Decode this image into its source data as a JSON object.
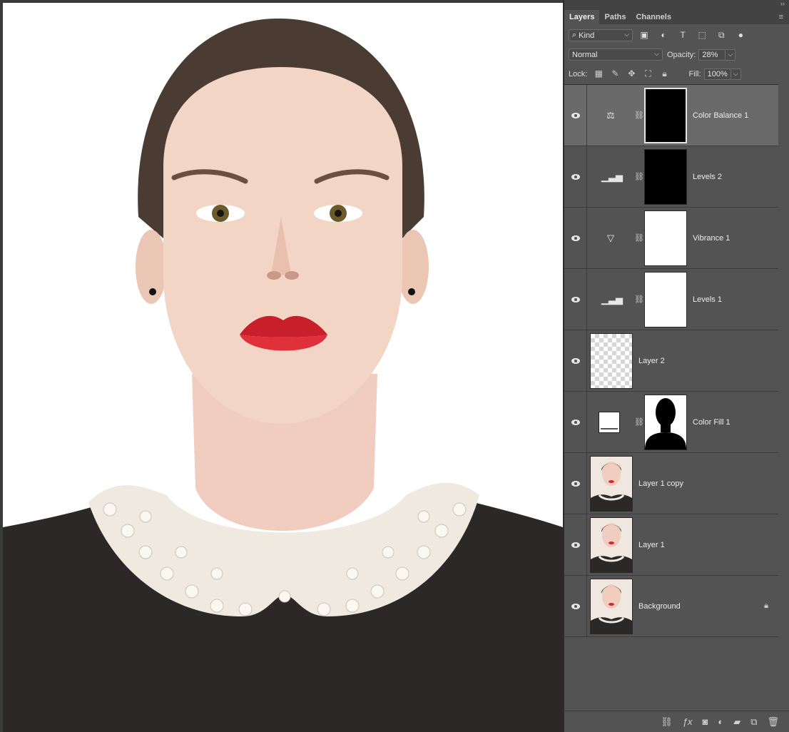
{
  "panel": {
    "collapse_glyph": "››",
    "tabs": [
      {
        "label": "Layers"
      },
      {
        "label": "Paths"
      },
      {
        "label": "Channels"
      }
    ],
    "menu_glyph": "≡",
    "filter": {
      "value": "Kind"
    },
    "blend": {
      "mode": "Normal",
      "opacity_label": "Opacity:",
      "opacity": "28%"
    },
    "lock": {
      "label": "Lock:",
      "fill_label": "Fill:",
      "fill": "100%"
    }
  },
  "layers": [
    {
      "name": "Color Balance 1",
      "icon": "balance-icon",
      "mask": "black",
      "selected": true
    },
    {
      "name": "Levels 2",
      "icon": "levels-icon",
      "mask": "black"
    },
    {
      "name": "Vibrance 1",
      "icon": "vibrance-icon",
      "mask": "white"
    },
    {
      "name": "Levels 1",
      "icon": "levels-icon",
      "mask": "white"
    },
    {
      "name": "Layer 2",
      "icon": "transparent-thumbnail"
    },
    {
      "name": "Color Fill 1",
      "icon": "color-fill-icon",
      "mask": "silhouette"
    },
    {
      "name": "Layer 1 copy",
      "icon": "portrait-thumbnail"
    },
    {
      "name": "Layer 1",
      "icon": "portrait-thumbnail"
    },
    {
      "name": "Background",
      "icon": "portrait-thumbnail",
      "locked": true
    }
  ],
  "colors": {
    "panel_bg": "#535353",
    "selected_row": "#6a6a6a",
    "canvas_bg": "#ffffff",
    "sweater": "#2c2828",
    "lips": "#d8262f",
    "skin": "#f0d0c0"
  }
}
